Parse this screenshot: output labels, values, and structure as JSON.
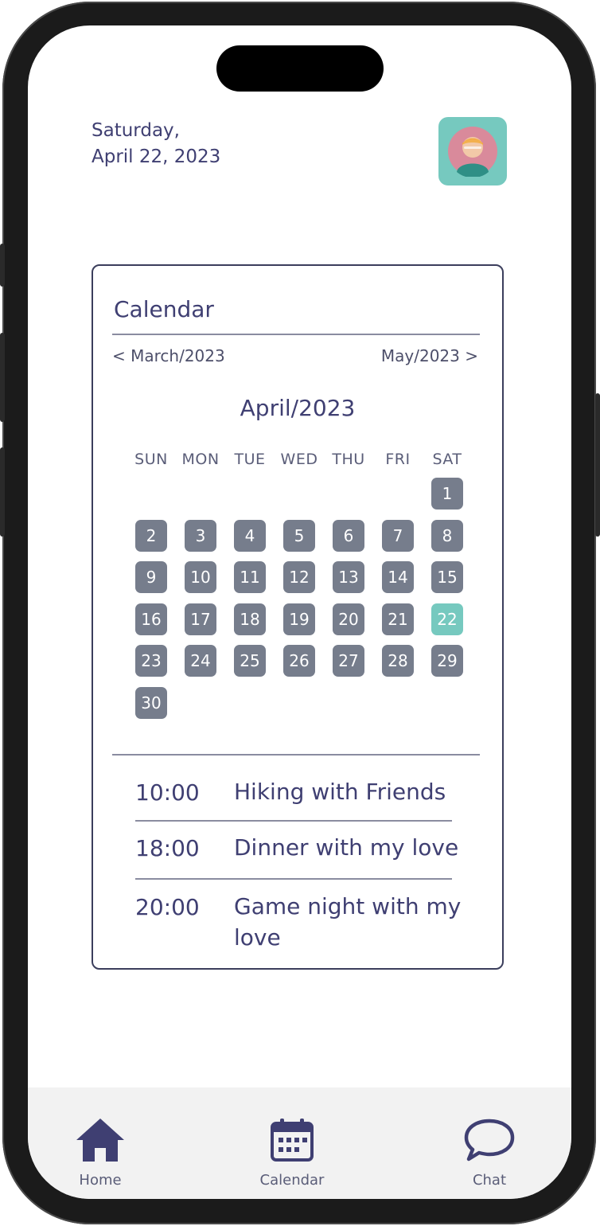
{
  "header": {
    "date_line1": "Saturday,",
    "date_line2": "April 22, 2023",
    "avatar_icon": "user-avatar-icon"
  },
  "calendar": {
    "title": "Calendar",
    "prev_label": "< March/2023",
    "next_label": "May/2023 >",
    "month_title": "April/2023",
    "weekdays": [
      "SUN",
      "MON",
      "TUE",
      "WED",
      "THU",
      "FRI",
      "SAT"
    ],
    "days": [
      "1",
      "2",
      "3",
      "4",
      "5",
      "6",
      "7",
      "8",
      "9",
      "10",
      "11",
      "12",
      "13",
      "14",
      "15",
      "16",
      "17",
      "18",
      "19",
      "20",
      "21",
      "22",
      "23",
      "24",
      "25",
      "26",
      "27",
      "28",
      "29",
      "30"
    ],
    "selected_day": "22"
  },
  "events": [
    {
      "time": "10:00",
      "title": "Hiking with Friends"
    },
    {
      "time": "18:00",
      "title": "Dinner with my love"
    },
    {
      "time": "20:00",
      "title": "Game night with my love"
    }
  ],
  "bottom_nav": {
    "home": "Home",
    "calendar": "Calendar",
    "chat": "Chat"
  },
  "colors": {
    "primary_text": "#3f3f72",
    "accent": "#76c9bf",
    "day_cell": "#767d8c",
    "nav_bar": "#f2f2f2"
  }
}
